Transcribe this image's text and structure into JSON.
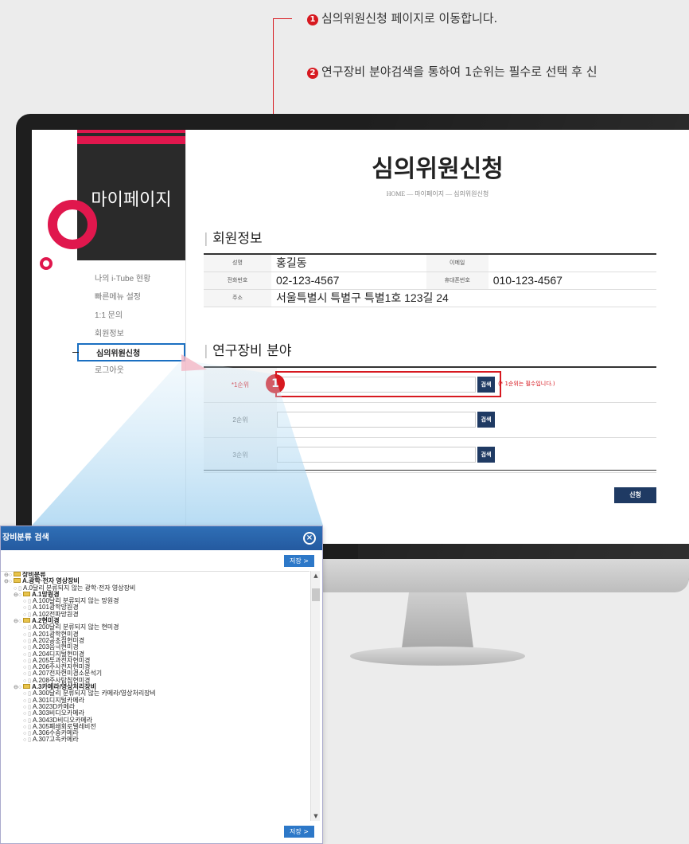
{
  "instructions": {
    "step1_num": "1",
    "step1": "심의위원신청 페이지로 이동합니다.",
    "step2_num": "2",
    "step2": "연구장비 분야검색을 통하여 1순위는 필수로 선택 후 신"
  },
  "sidebar": {
    "title": "마이페이지",
    "items": [
      {
        "label": "나의 i-Tube 현황"
      },
      {
        "label": "빠른메뉴 설정"
      },
      {
        "label": "1:1 문의"
      },
      {
        "label": "회원정보"
      },
      {
        "label": "심의위원신청"
      },
      {
        "label": "로그아웃"
      }
    ]
  },
  "page": {
    "title": "심의위원신청",
    "breadcrumb": "HOME  —  마이페이지  —  심의위원신청"
  },
  "member": {
    "section_title": "회원정보",
    "name_label": "성명",
    "name": "홍길동",
    "email_label": "이메일",
    "email": "",
    "phone_label": "전화번호",
    "phone": "02-123-4567",
    "mobile_label": "휴대폰번호",
    "mobile": "010-123-4567",
    "address_label": "주소",
    "address": "서울특별시 특별구 특별1호 123길 24"
  },
  "equipment": {
    "section_title": "연구장비 분야",
    "rows": [
      {
        "label": "*1순위",
        "value": "",
        "button": "검색",
        "note": "(* 1순위는 필수입니다.)"
      },
      {
        "label": "2순위",
        "value": "",
        "button": "검색"
      },
      {
        "label": "3순위",
        "value": "",
        "button": "검색"
      }
    ],
    "submit": "신청",
    "marker": "1"
  },
  "popup": {
    "title": "장비분류 검색",
    "close": "⊗",
    "save": "저장 >",
    "tree": [
      {
        "indent": 0,
        "text": "장비분류",
        "folder": true,
        "bold": true
      },
      {
        "indent": 0,
        "text": "A.광학·전자 영상장비",
        "folder": true,
        "bold": true
      },
      {
        "indent": 1,
        "text": "A.0달리 분류되지 않는 광학·전자 영상장비",
        "folder": false
      },
      {
        "indent": 1,
        "text": "A.1망원경",
        "folder": true,
        "bold": true
      },
      {
        "indent": 2,
        "text": "A.100달리 분류되지 않는 망원경",
        "folder": false
      },
      {
        "indent": 2,
        "text": "A.101광학망원경",
        "folder": false
      },
      {
        "indent": 2,
        "text": "A.102전파망원경",
        "folder": false
      },
      {
        "indent": 1,
        "text": "A.2현미경",
        "folder": true,
        "bold": true
      },
      {
        "indent": 2,
        "text": "A.200달리 분류되지 않는 현미경",
        "folder": false
      },
      {
        "indent": 2,
        "text": "A.201광학현미경",
        "folder": false
      },
      {
        "indent": 2,
        "text": "A.202공초점현미경",
        "folder": false
      },
      {
        "indent": 2,
        "text": "A.203음극현미경",
        "folder": false
      },
      {
        "indent": 2,
        "text": "A.204디지털현미경",
        "folder": false
      },
      {
        "indent": 2,
        "text": "A.205투과전자현미경",
        "folder": false
      },
      {
        "indent": 2,
        "text": "A.206주사전자현미경",
        "folder": false
      },
      {
        "indent": 2,
        "text": "A.207전자현미경소분석기",
        "folder": false
      },
      {
        "indent": 2,
        "text": "A.208주사탐침현미경",
        "folder": false
      },
      {
        "indent": 1,
        "text": "A.3카메라/영상처리장비",
        "folder": true,
        "bold": true
      },
      {
        "indent": 2,
        "text": "A.300달리 분류되지 않는 카메라/영상처리장비",
        "folder": false
      },
      {
        "indent": 2,
        "text": "A.301디지털카메라",
        "folder": false
      },
      {
        "indent": 2,
        "text": "A.3023D카메라",
        "folder": false
      },
      {
        "indent": 2,
        "text": "A.303비디오카메라",
        "folder": false
      },
      {
        "indent": 2,
        "text": "A.3043D비디오카메라",
        "folder": false
      },
      {
        "indent": 2,
        "text": "A.305폐쇄회로텔레비전",
        "folder": false
      },
      {
        "indent": 2,
        "text": "A.306수중카메라",
        "folder": false
      },
      {
        "indent": 2,
        "text": "A.307고속카메라",
        "folder": false
      }
    ]
  },
  "colors": {
    "accent": "#d71920",
    "navy": "#1f3a63",
    "popup_header": "#2f6fb6",
    "pink": "#e0174d"
  }
}
